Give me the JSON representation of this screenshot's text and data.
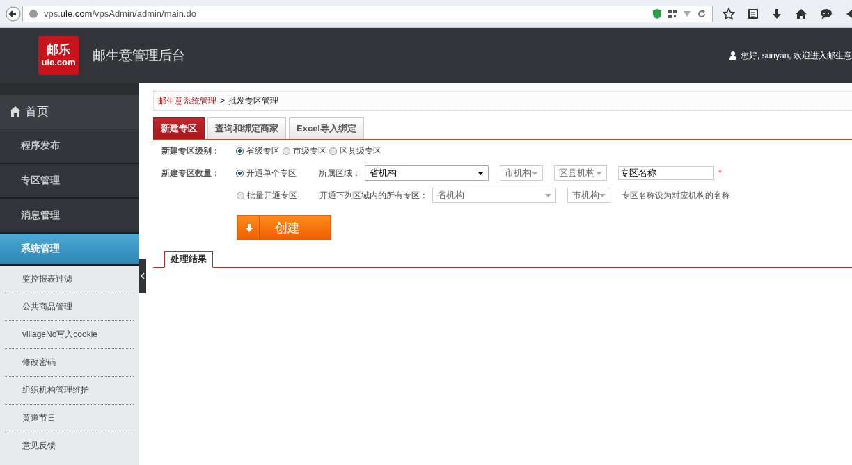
{
  "browser": {
    "url_host": "vps.",
    "url_domain": "ule.com",
    "url_path": "/vpsAdmin/admin/main.do"
  },
  "header": {
    "logo_top": "邮乐",
    "logo_bottom": "ule.com",
    "title": "邮生意管理后台",
    "greeting": "您好, sunyan, 欢迎进入邮生意"
  },
  "sidebar": {
    "home": "首页",
    "items": [
      {
        "label": "程序发布",
        "selected": false
      },
      {
        "label": "专区管理",
        "selected": false
      },
      {
        "label": "消息管理",
        "selected": false
      },
      {
        "label": "系统管理",
        "selected": true
      }
    ],
    "subitems": [
      "监控报表过滤",
      "公共商品管理",
      "villageNo写入cookie",
      "修改密码",
      "组织机构管理维护",
      "黄道节日",
      "意见反馈"
    ]
  },
  "breadcrumb": {
    "parent": "邮生意系统管理",
    "separator": ">",
    "current": "批发专区管理"
  },
  "tabs": [
    {
      "label": "新建专区",
      "selected": true
    },
    {
      "label": "查询和绑定商家",
      "selected": false
    },
    {
      "label": "Excel导入绑定",
      "selected": false
    }
  ],
  "form": {
    "level_label": "新建专区级别：",
    "levels": [
      {
        "label": "省级专区",
        "selected": true
      },
      {
        "label": "市级专区",
        "selected": false
      },
      {
        "label": "区县级专区",
        "selected": false
      }
    ],
    "count_label": "新建专区数量：",
    "single": {
      "label": "开通单个专区",
      "selected": true,
      "area_label": "所属区域：",
      "selects": [
        {
          "value": "省机构",
          "disabled": false
        },
        {
          "value": "市机构",
          "disabled": true
        },
        {
          "value": "区县机构",
          "disabled": true
        }
      ],
      "name_value": "专区名称",
      "required": "*"
    },
    "batch": {
      "label": "批量开通专区",
      "selected": false,
      "area_label": "开通下列区域内的所有专区：",
      "selects": [
        {
          "value": "省机构",
          "disabled": true
        },
        {
          "value": "市机构",
          "disabled": true
        }
      ],
      "note": "专区名称设为对应机构的名称"
    },
    "create_button": "创建"
  },
  "result_tab": "处理结果"
}
